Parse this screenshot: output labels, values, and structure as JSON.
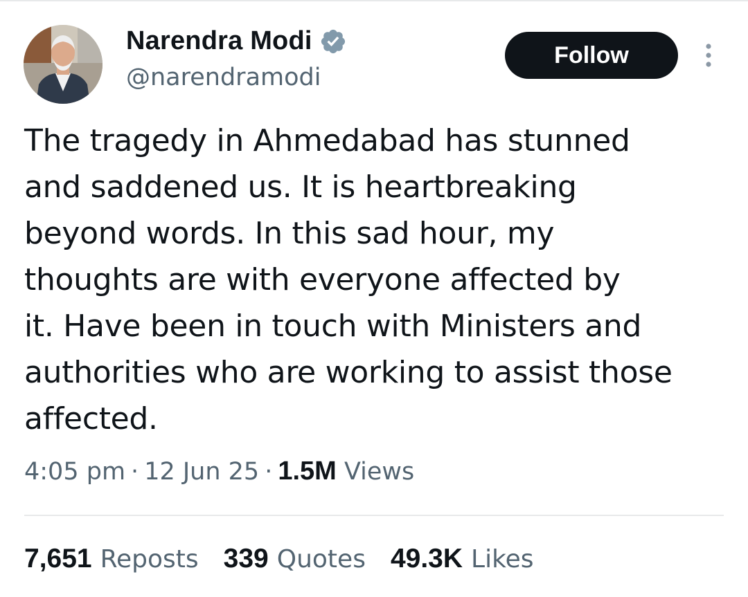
{
  "author": {
    "display_name": "Narendra Modi",
    "handle": "@narendramodi",
    "verified_icon": "verified-badge-icon",
    "badge_color": "#829aab"
  },
  "actions": {
    "follow_label": "Follow",
    "more_icon": "more-vertical-icon"
  },
  "tweet": {
    "text": "The tragedy in Ahmedabad has stunned\nand saddened us. It is heartbreaking\nbeyond words. In this sad hour, my\nthoughts are with everyone affected by\nit. Have been in touch with Ministers and\nauthorities who are working to assist those\naffected."
  },
  "meta": {
    "time": "4:05 pm",
    "separator": "·",
    "date": "12 Jun 25",
    "views_count": "1.5M",
    "views_label": "Views"
  },
  "stats": [
    {
      "count": "7,651",
      "label": "Reposts"
    },
    {
      "count": "339",
      "label": "Quotes"
    },
    {
      "count": "49.3K",
      "label": "Likes"
    }
  ],
  "colors": {
    "text_primary": "#0f1419",
    "text_secondary": "#536471",
    "button_bg": "#0f1419",
    "divider": "#e7e9ea"
  }
}
